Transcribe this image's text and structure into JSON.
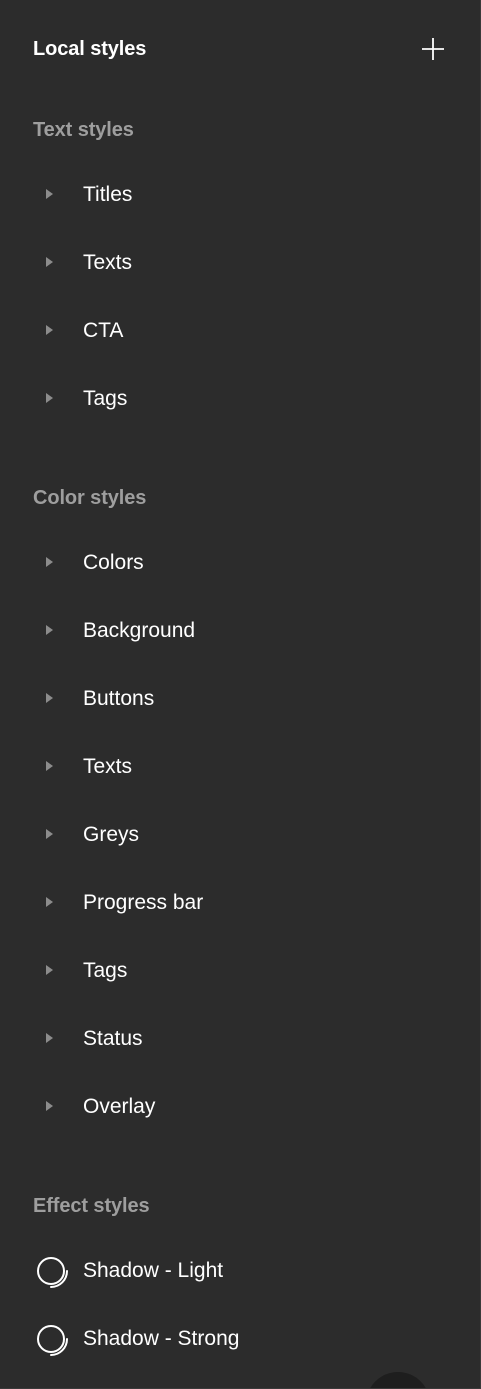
{
  "header": {
    "title": "Local styles",
    "add_icon": "plus-icon"
  },
  "text_styles": {
    "title": "Text styles",
    "items": [
      {
        "label": "Titles"
      },
      {
        "label": "Texts"
      },
      {
        "label": "CTA"
      },
      {
        "label": "Tags"
      }
    ]
  },
  "color_styles": {
    "title": "Color styles",
    "items": [
      {
        "label": "Colors"
      },
      {
        "label": "Background"
      },
      {
        "label": "Buttons"
      },
      {
        "label": "Texts"
      },
      {
        "label": "Greys"
      },
      {
        "label": "Progress bar"
      },
      {
        "label": "Tags"
      },
      {
        "label": "Status"
      },
      {
        "label": "Overlay"
      }
    ]
  },
  "effect_styles": {
    "title": "Effect styles",
    "items": [
      {
        "label": "Shadow - Light",
        "icon": "drop-shadow-icon"
      },
      {
        "label": "Shadow - Strong",
        "icon": "drop-shadow-icon"
      }
    ]
  },
  "colors": {
    "background": "#2c2c2c",
    "text_primary": "#ffffff",
    "text_secondary": "#9e9e9e",
    "caret": "#8c8c8c"
  }
}
